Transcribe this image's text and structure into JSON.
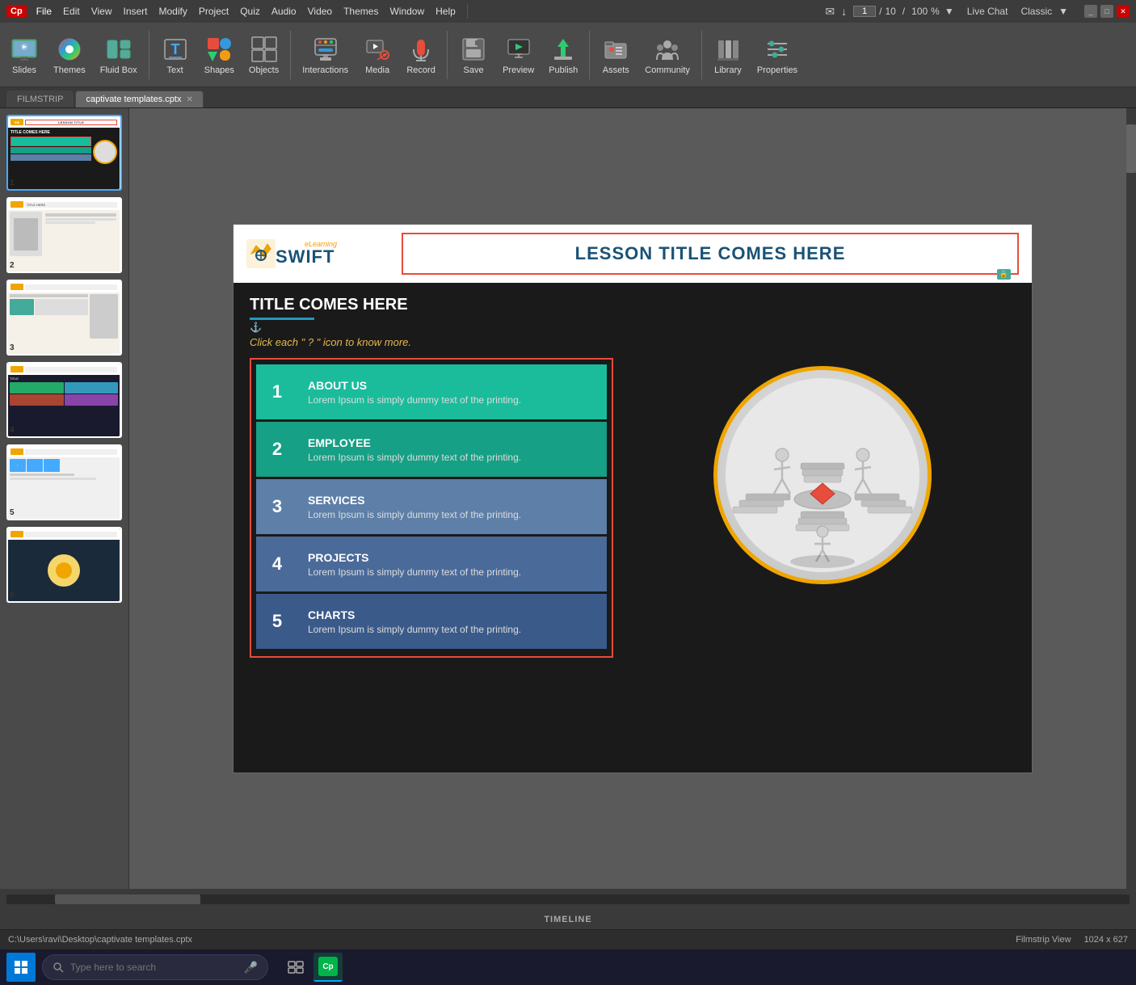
{
  "app": {
    "logo": "Cp",
    "title_bar": {
      "menu_items": [
        "File",
        "Edit",
        "View",
        "Insert",
        "Modify",
        "Project",
        "Quiz",
        "Audio",
        "Video",
        "Themes",
        "Window",
        "Help"
      ],
      "active_menu": "File",
      "live_chat": "Live Chat",
      "theme": "Classic",
      "page_current": "1",
      "page_separator": "/",
      "page_total": "10",
      "zoom": "100"
    }
  },
  "toolbar": {
    "groups": [
      {
        "id": "slides",
        "label": "Slides",
        "icon": "slides-icon"
      },
      {
        "id": "themes",
        "label": "Themes",
        "icon": "themes-icon"
      },
      {
        "id": "fluid_box",
        "label": "Fluid Box",
        "icon": "fluid-icon"
      },
      {
        "id": "text",
        "label": "Text",
        "icon": "text-icon"
      },
      {
        "id": "shapes",
        "label": "Shapes",
        "icon": "shapes-icon"
      },
      {
        "id": "objects",
        "label": "Objects",
        "icon": "objects-icon"
      },
      {
        "id": "interactions",
        "label": "Interactions",
        "icon": "interactions-icon"
      },
      {
        "id": "media",
        "label": "Media",
        "icon": "media-icon"
      },
      {
        "id": "record",
        "label": "Record",
        "icon": "record-icon"
      },
      {
        "id": "save",
        "label": "Save",
        "icon": "save-icon"
      },
      {
        "id": "preview",
        "label": "Preview",
        "icon": "preview-icon"
      },
      {
        "id": "publish",
        "label": "Publish",
        "icon": "publish-icon"
      },
      {
        "id": "assets",
        "label": "Assets",
        "icon": "assets-icon"
      },
      {
        "id": "community",
        "label": "Community",
        "icon": "community-icon"
      },
      {
        "id": "library",
        "label": "Library",
        "icon": "library-icon"
      },
      {
        "id": "properties",
        "label": "Properties",
        "icon": "properties-icon"
      }
    ]
  },
  "tabs": {
    "filmstrip": "FILMSTRIP",
    "file": "captivate templates.cptx"
  },
  "slide": {
    "header": {
      "elearning": "eLearning",
      "brand": "SWIFT",
      "lesson_title": "LESSON TITLE COMES HERE"
    },
    "body": {
      "title": "TITLE COMES HERE",
      "instruction": "Click each \" ? \" icon to know more.",
      "items": [
        {
          "num": "1",
          "title": "ABOUT US",
          "desc": "Lorem Ipsum is simply dummy text of the printing."
        },
        {
          "num": "2",
          "title": "EMPLOYEE",
          "desc": "Lorem Ipsum is simply dummy text of the printing."
        },
        {
          "num": "3",
          "title": "SERVICES",
          "desc": "Lorem Ipsum is simply dummy text of the printing."
        },
        {
          "num": "4",
          "title": "PROJECTS",
          "desc": "Lorem Ipsum is simply dummy text of the printing."
        },
        {
          "num": "5",
          "title": "CHARTS",
          "desc": "Lorem Ipsum is simply dummy text of the printing."
        }
      ]
    }
  },
  "filmstrip": {
    "slides": [
      {
        "num": "1",
        "active": true
      },
      {
        "num": "2",
        "active": false
      },
      {
        "num": "3",
        "active": false
      },
      {
        "num": "4",
        "active": false
      },
      {
        "num": "5",
        "active": false
      },
      {
        "num": "6",
        "active": false
      }
    ]
  },
  "bottom": {
    "timeline_label": "TIMELINE"
  },
  "status_bar": {
    "path": "C:\\Users\\ravi\\Desktop\\captivate templates.cptx",
    "view": "Filmstrip View",
    "dimensions": "1024 x 627"
  },
  "taskbar": {
    "search_placeholder": "Type here to search"
  }
}
